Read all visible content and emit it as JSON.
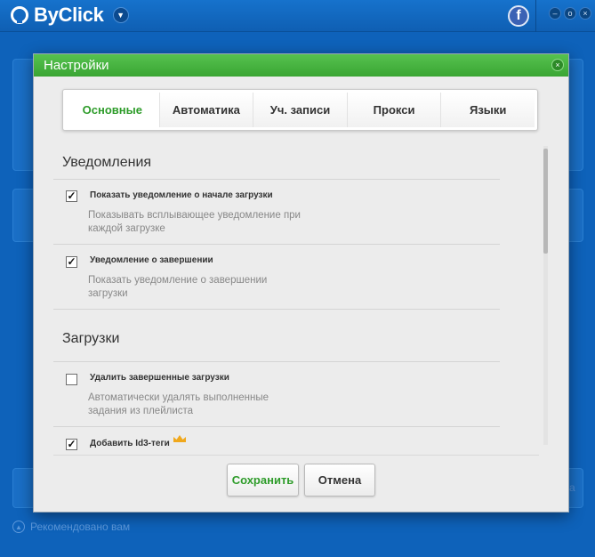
{
  "app": {
    "title": "ByClick"
  },
  "background": {
    "recommend_label": "Рекомендовано вам",
    "side_letter": "a"
  },
  "dialog": {
    "title": "Настройки",
    "tabs": [
      {
        "label": "Основные",
        "active": true
      },
      {
        "label": "Автоматика",
        "active": false
      },
      {
        "label": "Уч. записи",
        "active": false
      },
      {
        "label": "Прокси",
        "active": false
      },
      {
        "label": "Языки",
        "active": false
      }
    ],
    "sections": {
      "notifications": {
        "title": "Уведомления",
        "options": [
          {
            "label": "Показать уведомление о начале загрузки",
            "description": "Показывать всплывающее уведомление при каждой загрузке",
            "checked": true
          },
          {
            "label": "Уведомление о завершении",
            "description": "Показать уведомление о завершении загрузки",
            "checked": true
          }
        ]
      },
      "downloads": {
        "title": "Загрузки",
        "options": [
          {
            "label": "Удалить завершенные загрузки",
            "description": "Автоматически удалять выполненные задания из плейлиста",
            "checked": false
          },
          {
            "label": "Добавить Id3-теги",
            "description": "",
            "checked": true,
            "premium_icon": "crown-icon"
          }
        ]
      }
    },
    "buttons": {
      "save": "Сохранить",
      "cancel": "Отмена"
    }
  },
  "colors": {
    "accent_green": "#2e9c2a",
    "header_green": "#46b33f",
    "app_blue": "#0e62ba",
    "crown_gold": "#f0a81c"
  }
}
